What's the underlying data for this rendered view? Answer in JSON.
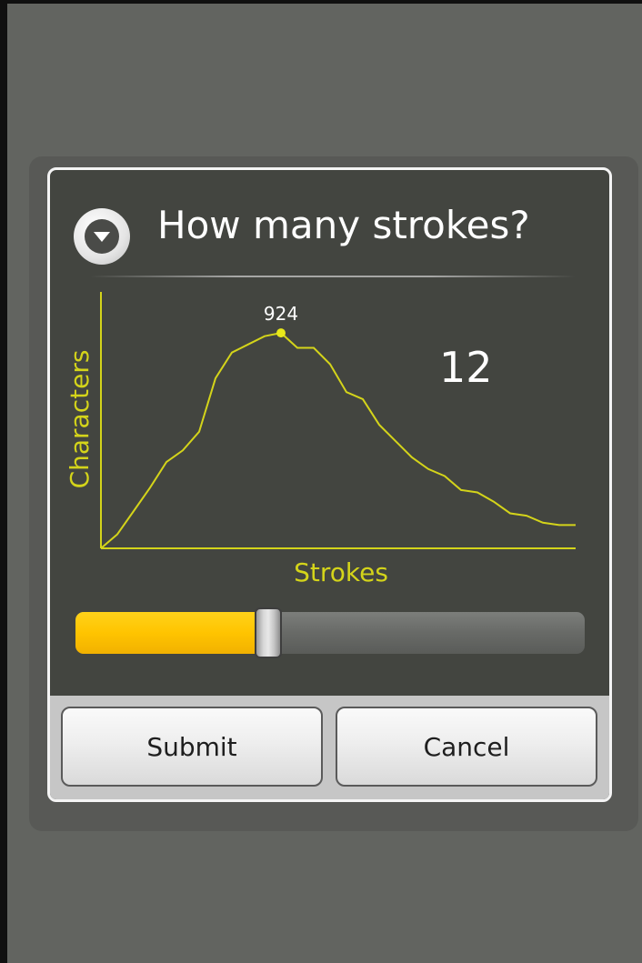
{
  "dialog": {
    "title": "How many strokes?",
    "icon": "circle-chevron-down-icon",
    "value": "12",
    "slider": {
      "value": 12,
      "min": 1,
      "max": 30
    },
    "buttons": {
      "submit": "Submit",
      "cancel": "Cancel"
    }
  },
  "colors": {
    "background": "#626460",
    "dialog": "#434540",
    "chart": "#d4d41a",
    "slider_fill": "#ffc400"
  },
  "chart_data": {
    "type": "line",
    "xlabel": "Strokes",
    "ylabel": "Characters",
    "peak_label": "924",
    "peak_x": 12,
    "ylim": [
      0,
      1100
    ],
    "x": [
      1,
      2,
      3,
      4,
      5,
      6,
      7,
      8,
      9,
      10,
      11,
      12,
      13,
      14,
      15,
      16,
      17,
      18,
      19,
      20,
      21,
      22,
      23,
      24,
      25,
      26,
      27,
      28,
      29,
      30
    ],
    "values": [
      0,
      60,
      160,
      260,
      370,
      420,
      500,
      730,
      840,
      875,
      910,
      924,
      860,
      860,
      790,
      670,
      640,
      530,
      460,
      390,
      340,
      310,
      250,
      240,
      200,
      150,
      140,
      110,
      100,
      100
    ]
  }
}
